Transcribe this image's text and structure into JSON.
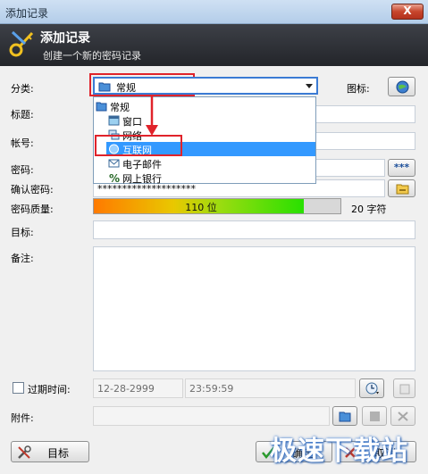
{
  "window": {
    "title": "添加记录",
    "close_label": "X"
  },
  "header": {
    "title": "添加记录",
    "subtitle": "创建一个新的密码记录"
  },
  "labels": {
    "category": "分类:",
    "icon": "图标:",
    "title": "标题:",
    "account": "帐号:",
    "password": "密码:",
    "confirm_password": "确认密码:",
    "password_quality": "密码质量:",
    "target": "目标:",
    "notes": "备注:",
    "expiry": "过期时间:",
    "attachment": "附件:"
  },
  "category": {
    "selected": "常规",
    "options": [
      {
        "label": "常规",
        "icon": "folder-icon",
        "selected": false
      },
      {
        "label": "窗口",
        "icon": "window-icon",
        "selected": false
      },
      {
        "label": "网络",
        "icon": "network-icon",
        "selected": false
      },
      {
        "label": "互联网",
        "icon": "internet-icon",
        "selected": true
      },
      {
        "label": "电子邮件",
        "icon": "email-icon",
        "selected": false
      },
      {
        "label": "网上银行",
        "icon": "bank-icon",
        "selected": false
      }
    ]
  },
  "password": {
    "reveal_label": "***",
    "confirm_value": "********************"
  },
  "quality": {
    "bits_label": "110 位",
    "chars_label": "20 字符",
    "level": 0.85
  },
  "expiry": {
    "date": "12-28-2999",
    "time": "23:59:59",
    "checked": false
  },
  "footer": {
    "tools_label": "目标",
    "ok_label": "确定",
    "cancel_label": "取消"
  },
  "watermark": "极速下载站",
  "colors": {
    "header_bg": "#2e3036",
    "selection": "#3399ff",
    "annotation_red": "#e0232b"
  }
}
